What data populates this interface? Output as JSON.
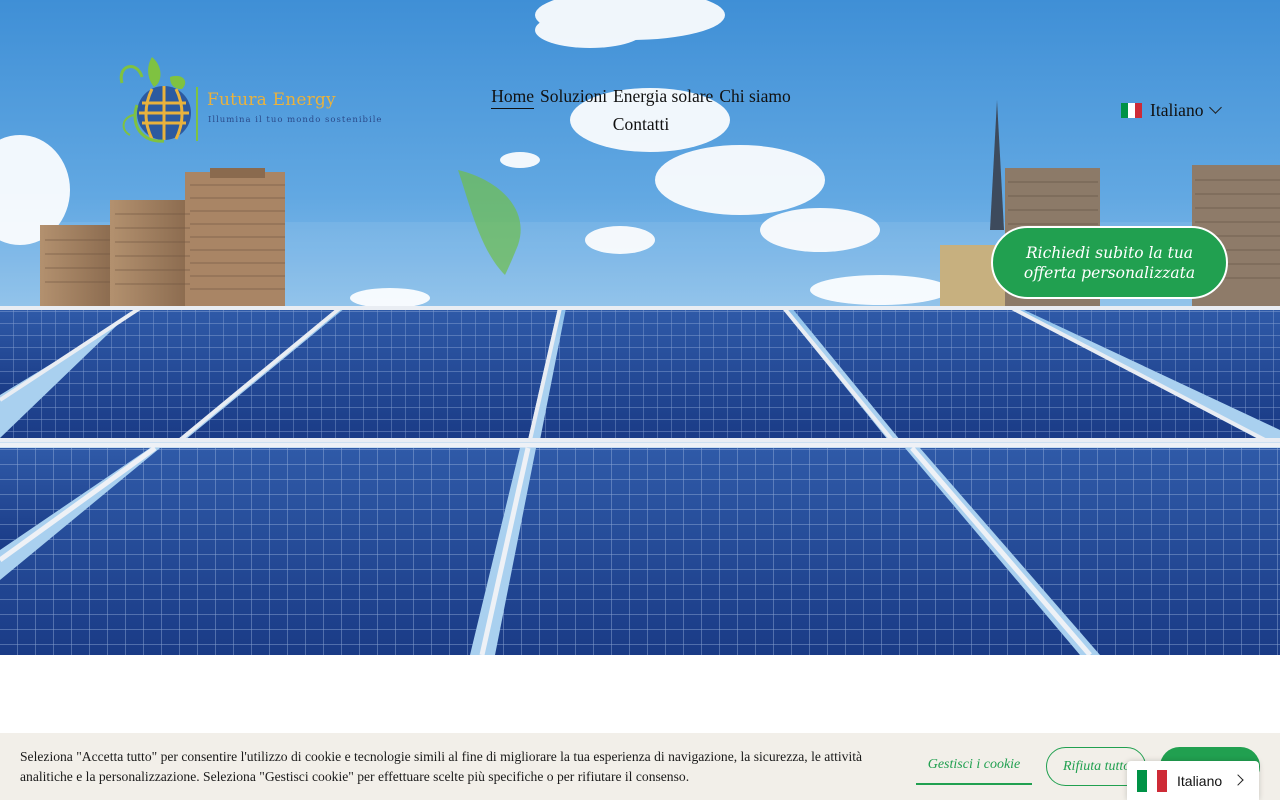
{
  "brand": {
    "name": "Futura Energy",
    "tagline": "Illumina il tuo mondo sostenibile"
  },
  "nav": {
    "items": [
      "Home",
      "Soluzioni",
      "Energia solare",
      "Chi siamo",
      "Contatti"
    ],
    "active": "Home"
  },
  "language": {
    "current": "Italiano",
    "flag_icon": "italy-flag-icon"
  },
  "hero": {
    "cta_label": "Richiedi subito la tua offerta personalizzata"
  },
  "cookie_banner": {
    "text": "Seleziona \"Accetta tutto\" per consentire l'utilizzo di cookie e tecnologie simili al fine di migliorare la tua esperienza di navigazione, la sicurezza, le attività analitiche e la personalizzazione. Seleziona \"Gestisci cookie\" per effettuare scelte più specifiche o per rifiutare il consenso.",
    "manage_label": "Gestisci i cookie",
    "refuse_label": "Rifiuta tutto"
  },
  "language_widget": {
    "label": "Italiano",
    "flag_icon": "italy-flag-icon",
    "arrow_icon": "chevron-right-icon"
  },
  "colors": {
    "accent_green": "#21a050",
    "flag_green": "#009246",
    "flag_white": "#ffffff",
    "flag_red": "#ce2b37",
    "banner_bg": "#f2efe9"
  }
}
